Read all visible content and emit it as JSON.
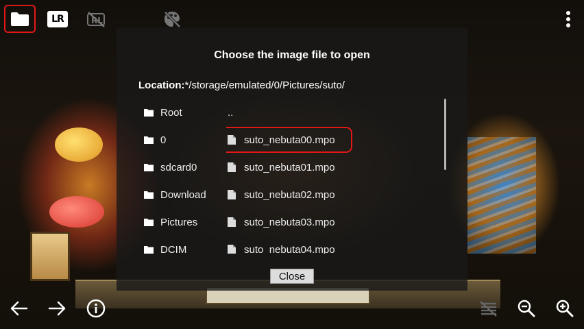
{
  "dialog": {
    "title": "Choose the image file to open",
    "location_label": "Location:",
    "location_path": "*/storage/emulated/0/Pictures/suto/",
    "close_label": "Close"
  },
  "directories": [
    {
      "label": "Root"
    },
    {
      "label": "0"
    },
    {
      "label": "sdcard0"
    },
    {
      "label": "Download"
    },
    {
      "label": "Pictures"
    },
    {
      "label": "DCIM"
    }
  ],
  "files": [
    {
      "label": ".."
    },
    {
      "label": "suto_nebuta00.mpo"
    },
    {
      "label": "suto_nebuta01.mpo"
    },
    {
      "label": "suto_nebuta02.mpo"
    },
    {
      "label": "suto_nebuta03.mpo"
    },
    {
      "label": "suto_nebuta04.mpo"
    }
  ],
  "toolbar": {
    "lr_label": "LR",
    "icons": [
      "folder-icon",
      "lr-icon",
      "rl-off-icon",
      "palette-off-icon",
      "more-vert-icon"
    ]
  },
  "bottombar": {
    "icons": [
      "arrow-left-icon",
      "arrow-right-icon",
      "info-icon",
      "list-off-icon",
      "zoom-out-icon",
      "zoom-in-icon"
    ]
  },
  "colors": {
    "highlight": "#e01818",
    "dialog_bg": "#191919"
  }
}
